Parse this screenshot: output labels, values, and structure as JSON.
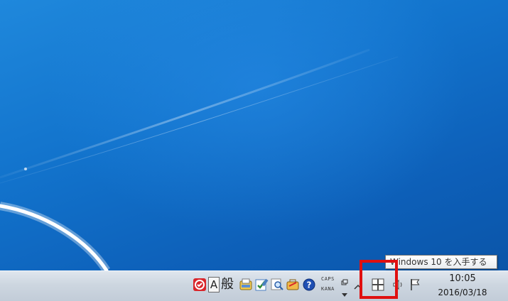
{
  "tooltip": {
    "text": "Windows 10 を入手する"
  },
  "clock": {
    "time": "10:05",
    "date": "2016/03/18"
  },
  "ime": {
    "mode_letter": "A",
    "input_type": "般",
    "caps_label": "CAPS",
    "kana_label": "KANA"
  },
  "tray": {
    "icons": [
      "antivirus-icon",
      "ime-pad-icon",
      "ime-dictionary-icon",
      "ime-search-icon",
      "ime-tools-icon",
      "help-icon",
      "language-bar-icon",
      "tray-overflow-chevron-icon",
      "get-windows-10-icon",
      "speaker-icon",
      "action-center-flag-icon"
    ]
  },
  "colors": {
    "highlight": "#e01010",
    "desktop_blue": "#1273cc"
  }
}
